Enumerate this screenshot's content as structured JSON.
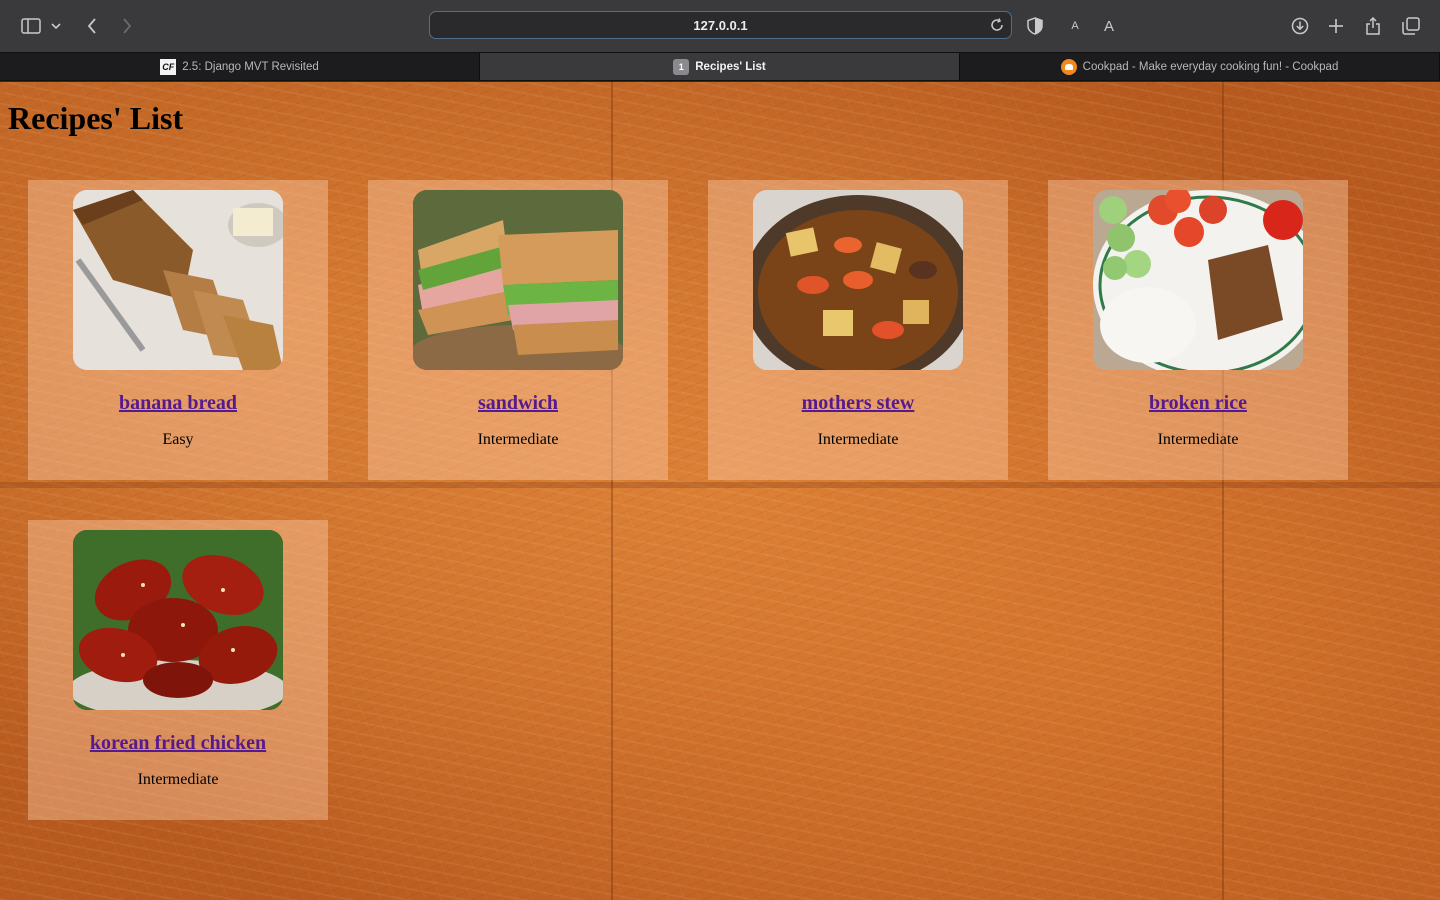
{
  "browser": {
    "url": "127.0.0.1",
    "tabs": [
      {
        "label": "2.5: Django MVT Revisited",
        "favicon": "cf-logo-icon",
        "active": false
      },
      {
        "label": "Recipes' List",
        "favicon": "tab-number-icon",
        "badge": "1",
        "active": true
      },
      {
        "label": "Cookpad - Make everyday cooking fun! - Cookpad",
        "favicon": "cookpad-icon",
        "active": false
      }
    ],
    "reader_small": "A",
    "reader_large": "A"
  },
  "page": {
    "title": "Recipes' List",
    "recipes": [
      {
        "name": "banana bread",
        "difficulty": "Easy",
        "image": "banana-bread-photo"
      },
      {
        "name": "sandwich",
        "difficulty": "Intermediate",
        "image": "sandwich-photo"
      },
      {
        "name": "mothers stew",
        "difficulty": "Intermediate",
        "image": "stew-photo"
      },
      {
        "name": "broken rice",
        "difficulty": "Intermediate",
        "image": "broken-rice-photo"
      },
      {
        "name": "korean fried chicken",
        "difficulty": "Intermediate",
        "image": "fried-chicken-photo"
      }
    ]
  },
  "colors": {
    "link": "#551a8b",
    "card_bg": "rgba(255,205,170,0.42)",
    "wood": "#c96a28"
  }
}
